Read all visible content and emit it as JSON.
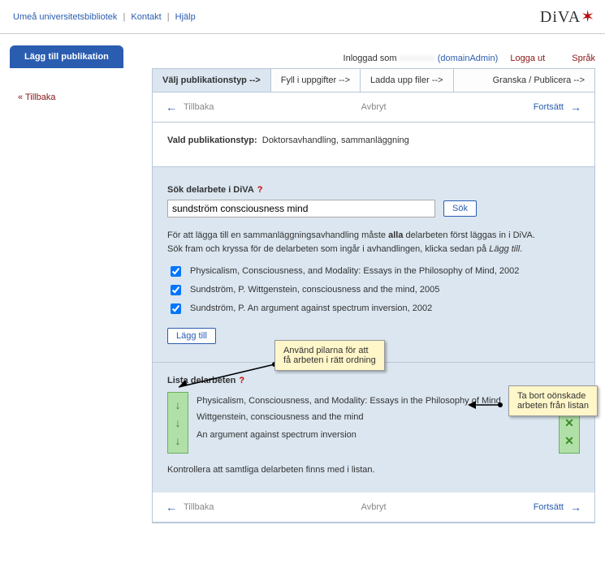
{
  "topbar": {
    "lib": "Umeå universitetsbibliotek",
    "contact": "Kontakt",
    "help": "Hjälp",
    "logo": "DiVA"
  },
  "maintab": "Lägg till publikation",
  "login": {
    "prefix": "Inloggad som",
    "user": "xxxxxxxx",
    "role": "(domainAdmin)",
    "logout": "Logga ut",
    "lang": "Språk"
  },
  "steps": {
    "s1": "Välj publikationstyp -->",
    "s2": "Fyll i uppgifter -->",
    "s3": "Ladda upp filer -->",
    "s4": "Granska / Publicera -->"
  },
  "nav": {
    "back": "Tillbaka",
    "cancel": "Avbryt",
    "forward": "Fortsätt"
  },
  "sidebar": {
    "back": "« Tillbaka"
  },
  "pubtype": {
    "label": "Vald publikationstyp:",
    "value": "Doktorsavhandling, sammanläggning"
  },
  "search": {
    "label": "Sök delarbete i DiVA",
    "value": "sundström consciousness mind",
    "button": "Sök"
  },
  "instructions": {
    "line1": "För att lägga till en sammanläggningsavhandling måste ",
    "bold": "alla",
    "line1b": " delarbeten först läggas in i DiVA.",
    "line2a": "Sök fram och kryssa för de delarbeten som ingår i avhandlingen, klicka sedan på ",
    "line2i": "Lägg till"
  },
  "results": [
    "Physicalism, Consciousness, and Modality: Essays in the Philosophy of Mind, 2002",
    "Sundström, P. Wittgenstein, consciousness and the mind, 2005",
    "Sundström, P. An argument against spectrum inversion, 2002"
  ],
  "addbtn": "Lägg till",
  "list": {
    "label": "Lista delarbeten",
    "items": [
      "Physicalism, Consciousness, and Modality: Essays in the Philosophy of Mind",
      "Wittgenstein, consciousness and the mind",
      "An argument against spectrum inversion"
    ],
    "check": "Kontrollera att samtliga delarbeten finns med i listan."
  },
  "callouts": {
    "c1a": "Använd pilarna för att",
    "c1b": "få arbeten i rätt ordning",
    "c2a": "Ta bort oönskade",
    "c2b": "arbeten från listan"
  }
}
